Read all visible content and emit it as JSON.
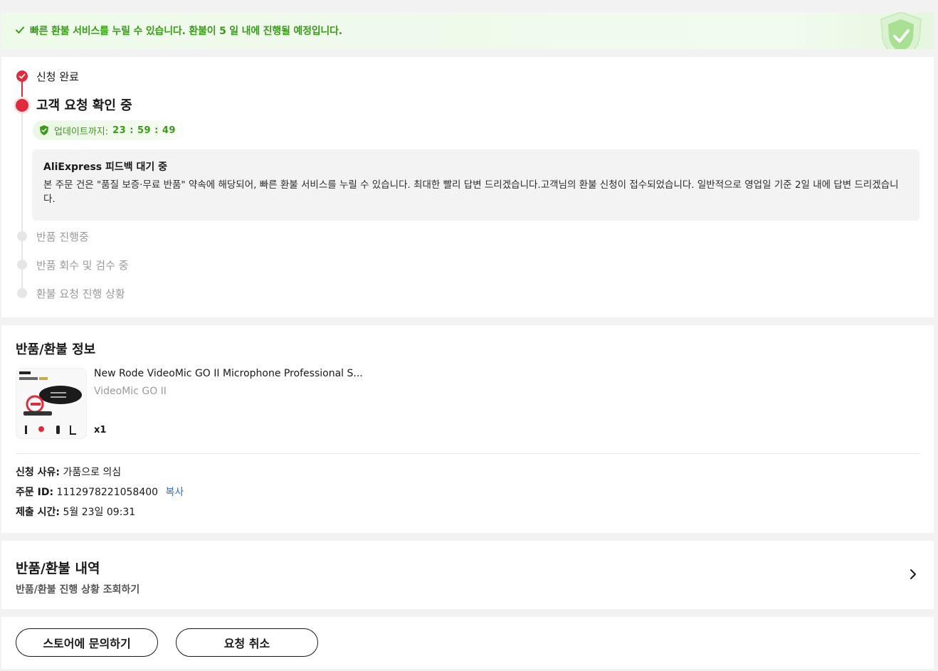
{
  "banner": {
    "message": "빠른 환불 서비스를 누릴 수 있습니다. 환불이 5 일 내에 진행될 예정입니다.",
    "icon": "check-icon",
    "badge_icon": "shield-check-icon",
    "color": "#3a9b1a"
  },
  "timeline": {
    "steps": [
      {
        "label": "신청 완료",
        "state": "done"
      },
      {
        "label": "고객 요청 확인 중",
        "state": "current"
      },
      {
        "label": "반품 진행중",
        "state": "pending"
      },
      {
        "label": "반품 회수 및 검수 중",
        "state": "pending"
      },
      {
        "label": "환불 요청 진행 상황",
        "state": "pending"
      }
    ],
    "timer_label": "업데이트까지:",
    "timer_value": "23 : 59 : 49",
    "feedback_title": "AliExpress 피드백 대기 중",
    "feedback_body": "본 주문 건은 \"품질 보증·무료 반품\" 약속에 해당되어, 빠른 환불 서비스를 누릴 수 있습니다. 최대한 빨리 답변 드리겠습니다.고객님의 환불 신청이 접수되었습니다. 일반적으로 영업일 기준 2일 내에 답변 드리겠습니다.",
    "accent_color": "#e02b3c"
  },
  "refund_info": {
    "title": "반품/환불 정보",
    "product_name": "New Rode VideoMic GO II Microphone Professional S...",
    "product_variant": "VideoMic GO II",
    "quantity": "x1",
    "reason_label": "신청 사유:",
    "reason_value": "가품으로 의심",
    "order_id_label": "주문 ID:",
    "order_id_value": "1112978221058400",
    "copy_label": "복사",
    "submit_label": "제출 시간:",
    "submit_value": "5월 23일 09:31"
  },
  "history": {
    "title": "반품/환불 내역",
    "subtitle": "반품/환불 진행 상황 조회하기"
  },
  "actions": {
    "store_button": "스토어에 문의하기",
    "cancel_button": "요청 취소"
  }
}
